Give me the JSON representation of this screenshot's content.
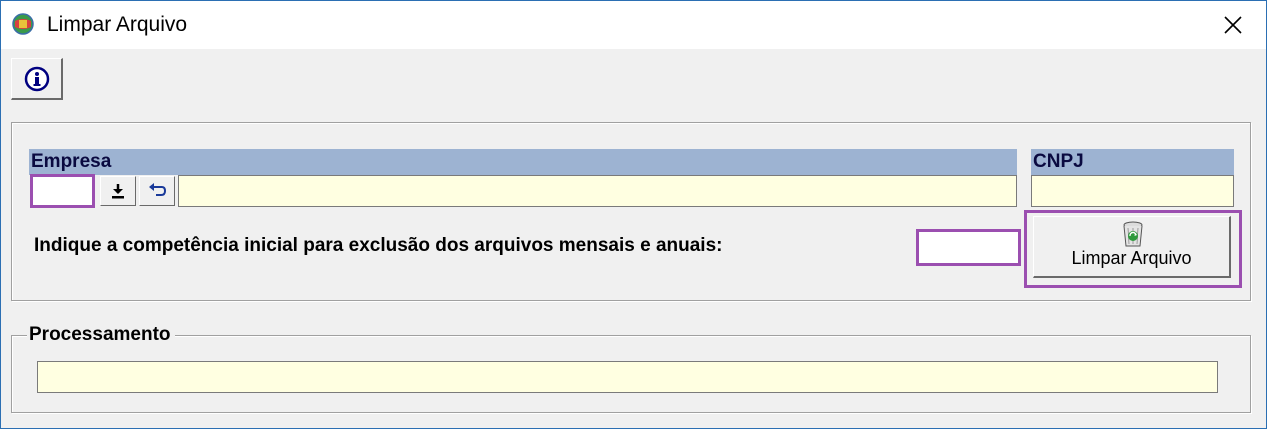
{
  "window": {
    "title": "Limpar Arquivo",
    "close_glyph": "✕",
    "app_icon": "globe-icon"
  },
  "toolbar": {
    "info_icon": "info-icon"
  },
  "empresa": {
    "header": "Empresa",
    "code_value": "",
    "name_value": "",
    "download_icon": "download-arrow-icon",
    "undo_icon": "undo-arrow-icon"
  },
  "cnpj": {
    "header": "CNPJ",
    "value": ""
  },
  "competencia": {
    "label": "Indique a competência inicial para exclusão dos arquivos mensais e anuais:",
    "value": ""
  },
  "limpar_button": {
    "label": "Limpar Arquivo",
    "icon": "recycle-bin-icon"
  },
  "processamento": {
    "legend": "Processamento",
    "value": ""
  },
  "colors": {
    "header_bg": "#9db3d2",
    "field_bg": "#ffffe1",
    "highlight": "#9b4fb0",
    "window_bg": "#f0f0f0"
  }
}
